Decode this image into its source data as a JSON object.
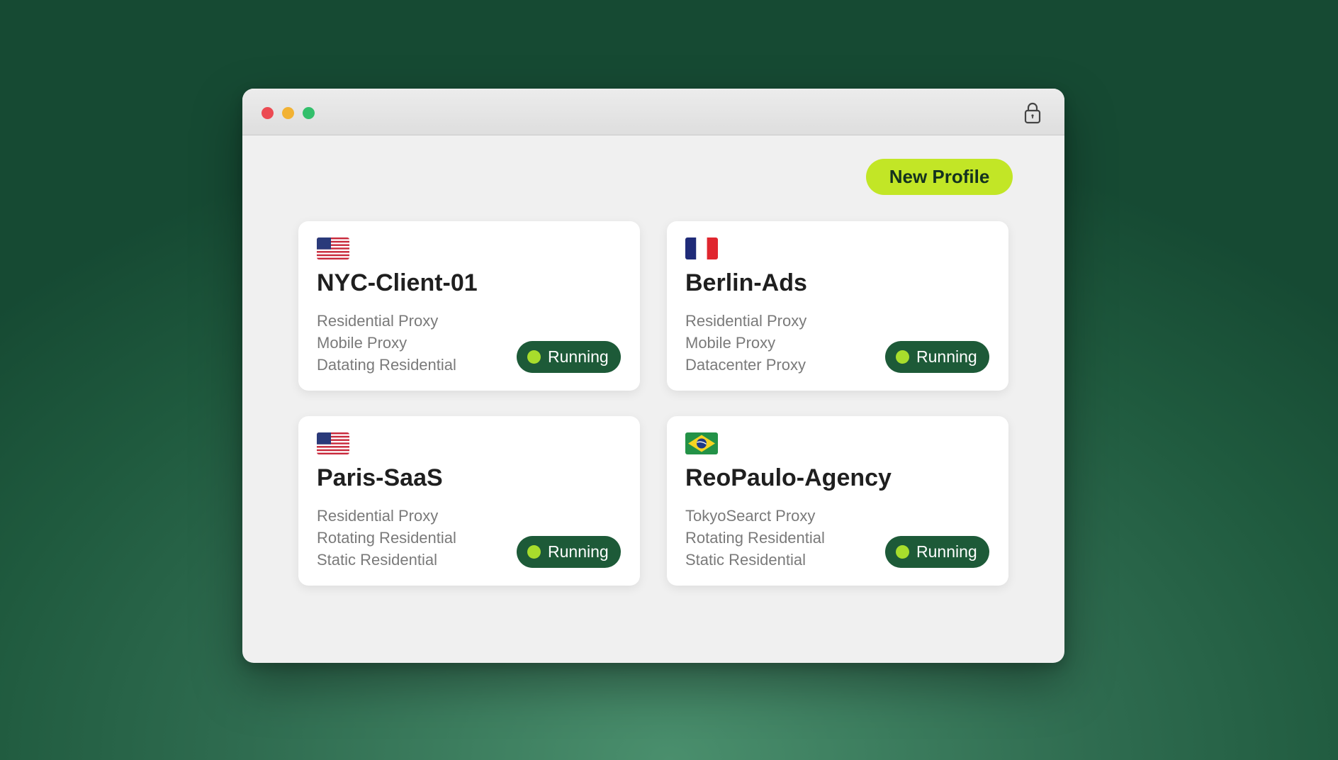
{
  "window": {
    "controls": [
      "close",
      "minimize",
      "maximize"
    ],
    "lock_icon": "lock-icon"
  },
  "toolbar": {
    "new_profile_label": "New Profile"
  },
  "colors": {
    "accent": "#c2e626",
    "status_bg": "#1d5a38",
    "status_dot": "#a8dd2c"
  },
  "profiles": [
    {
      "flag": "us-flag-icon",
      "name": "NYC-Client-01",
      "proxies": [
        "Residential Proxy",
        "Mobile Proxy",
        "Datating Residential"
      ],
      "status": "Running"
    },
    {
      "flag": "fr-flag-icon",
      "name": "Berlin-Ads",
      "proxies": [
        "Residential Proxy",
        "Mobile Proxy",
        "Datacenter Proxy"
      ],
      "status": "Running"
    },
    {
      "flag": "us-flag-icon",
      "name": "Paris-SaaS",
      "proxies": [
        "Residential Proxy",
        "Rotating Residential",
        "Static Residential"
      ],
      "status": "Running"
    },
    {
      "flag": "br-flag-icon",
      "name": "ReoPaulo-Agency",
      "proxies": [
        "TokyoSearct Proxy",
        "Rotating Residential",
        "Static Residential"
      ],
      "status": "Running"
    }
  ]
}
